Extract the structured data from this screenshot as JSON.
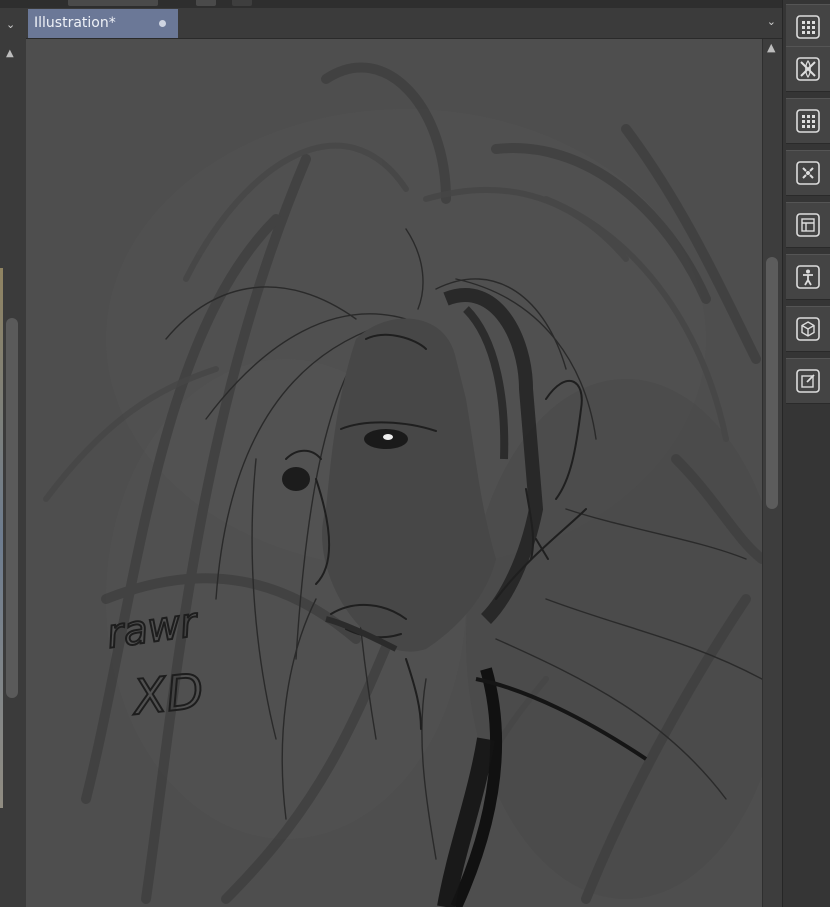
{
  "document": {
    "tab_title": "Illustration*"
  },
  "canvas": {
    "background_color": "#4e4e4e",
    "sketch_text": "rawr",
    "emote_text": "XD"
  },
  "right_toolbar": [
    {
      "icon": "grid-panel-icon"
    },
    {
      "icon": "x-panel-icon"
    },
    {
      "icon": "grid-panel-icon"
    },
    {
      "icon": "navigator-icon"
    },
    {
      "icon": "layer-property-icon"
    },
    {
      "icon": "figure-pose-icon"
    },
    {
      "icon": "3d-cube-icon"
    },
    {
      "icon": "edit-note-icon"
    }
  ],
  "colors": {
    "tab_active": "#6b7897",
    "panel_bg": "#3b3b3b",
    "toolbar_bg": "#353535"
  }
}
